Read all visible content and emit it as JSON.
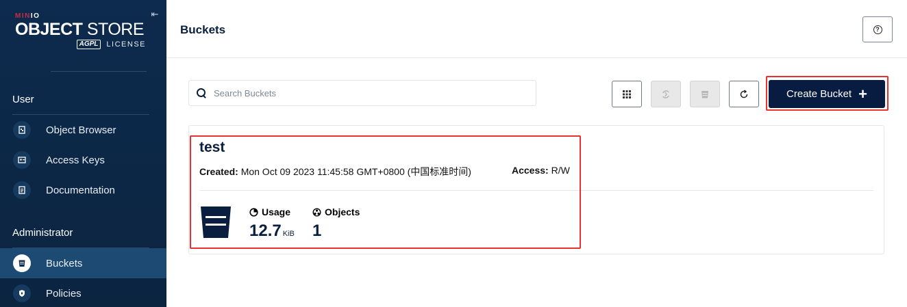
{
  "sidebar": {
    "brand_prefix": "MIN",
    "brand_suffix": "IO",
    "product_bold": "OBJECT",
    "product_rest": " STORE",
    "license_badge": "AGPL",
    "license_word": "LICENSE",
    "sections": [
      {
        "title": "User",
        "items": [
          {
            "label": "Object Browser",
            "icon": "object-browser-icon"
          },
          {
            "label": "Access Keys",
            "icon": "access-keys-icon"
          },
          {
            "label": "Documentation",
            "icon": "documentation-icon"
          }
        ]
      },
      {
        "title": "Administrator",
        "items": [
          {
            "label": "Buckets",
            "icon": "buckets-icon",
            "active": true
          },
          {
            "label": "Policies",
            "icon": "policies-icon"
          }
        ]
      }
    ]
  },
  "header": {
    "title": "Buckets",
    "help_icon": "help-icon"
  },
  "toolbar": {
    "search_placeholder": "Search Buckets",
    "buttons": [
      "grid-view-icon",
      "replication-icon",
      "lifecycle-icon",
      "refresh-icon"
    ],
    "create_label": "Create Bucket",
    "create_icon": "+"
  },
  "bucket": {
    "name": "test",
    "created_label": "Created:",
    "created_value": "Mon Oct 09 2023 11:45:58 GMT+0800 (中国标准时间)",
    "access_label": "Access:",
    "access_value": "R/W",
    "usage_label": "Usage",
    "usage_value": "12.7",
    "usage_unit": "KiB",
    "objects_label": "Objects",
    "objects_value": "1"
  },
  "colors": {
    "sidebar_bg": "#0d2b4e",
    "primary": "#081c42",
    "highlight": "#e8302e",
    "active_item": "#1d4a72"
  }
}
